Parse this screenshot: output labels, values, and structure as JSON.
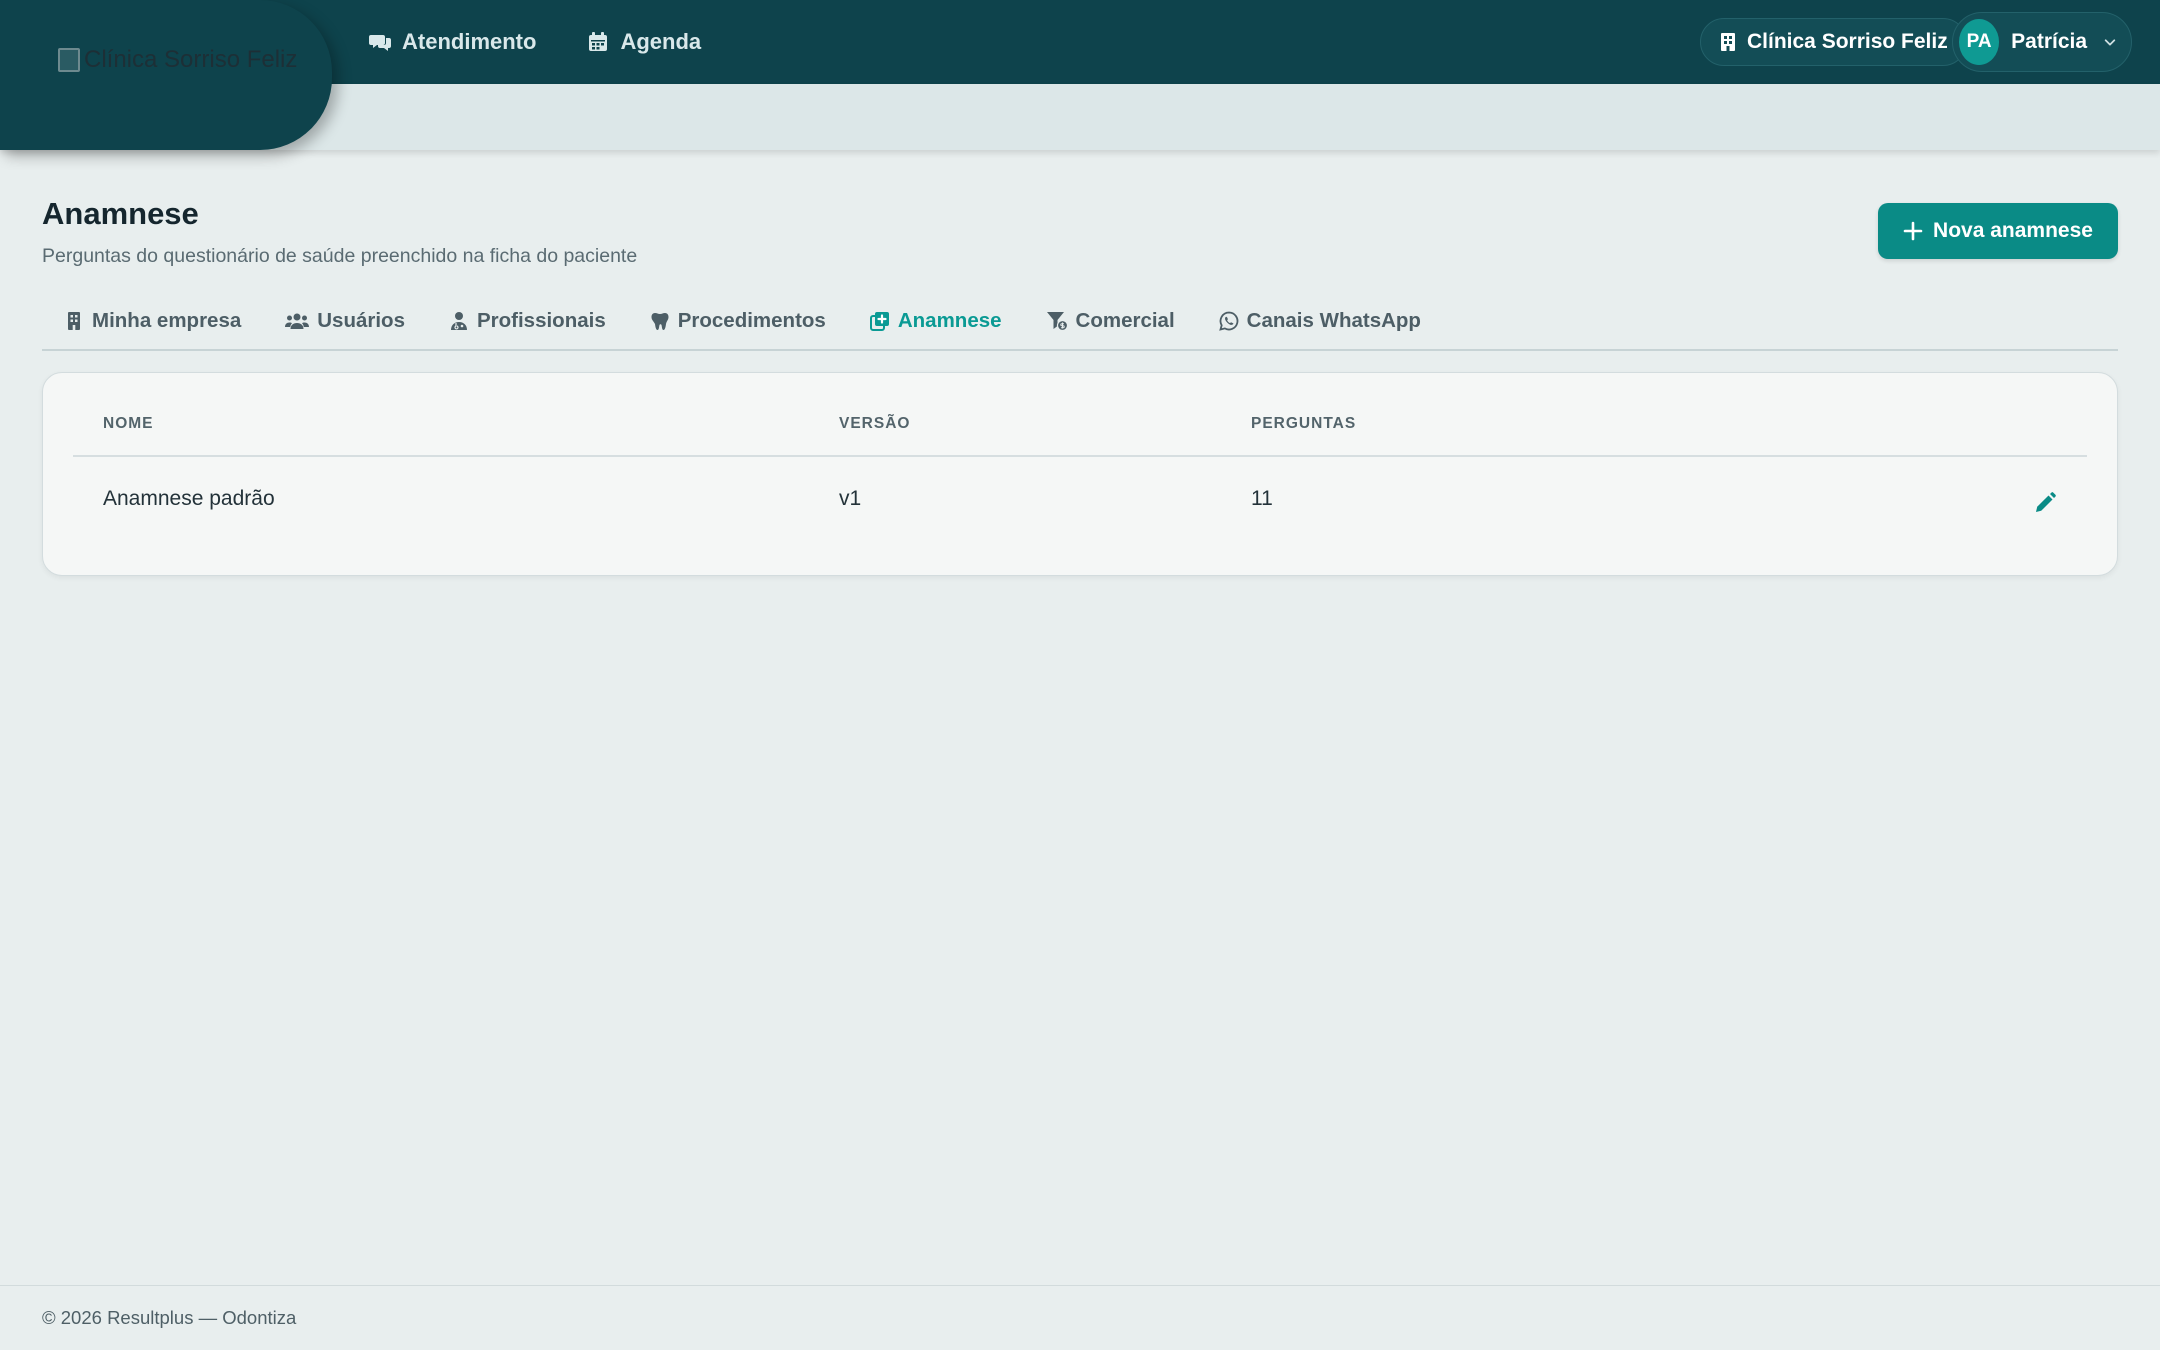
{
  "brand": {
    "logo_alt": "Clínica Sorriso Feliz"
  },
  "topnav": {
    "items": [
      {
        "label": "Atendimento",
        "icon": "chat-bubbles-icon"
      },
      {
        "label": "Agenda",
        "icon": "calendar-icon"
      }
    ]
  },
  "header": {
    "clinic_name": "Clínica Sorriso Feliz",
    "user_initials": "PA",
    "user_name": "Patrícia"
  },
  "page": {
    "title": "Anamnese",
    "subtitle": "Perguntas do questionário de saúde preenchido na ficha do paciente",
    "new_button_label": "Nova anamnese"
  },
  "tabs": [
    {
      "label": "Minha empresa",
      "icon": "building-icon",
      "active": false
    },
    {
      "label": "Usuários",
      "icon": "users-icon",
      "active": false
    },
    {
      "label": "Profissionais",
      "icon": "doctor-icon",
      "active": false
    },
    {
      "label": "Procedimentos",
      "icon": "tooth-icon",
      "active": false
    },
    {
      "label": "Anamnese",
      "icon": "notes-medical-icon",
      "active": true
    },
    {
      "label": "Comercial",
      "icon": "funnel-dollar-icon",
      "active": false
    },
    {
      "label": "Canais WhatsApp",
      "icon": "whatsapp-icon",
      "active": false
    }
  ],
  "table": {
    "columns": [
      "NOME",
      "VERSÃO",
      "PERGUNTAS"
    ],
    "rows": [
      {
        "nome": "Anamnese padrão",
        "versao": "v1",
        "perguntas": "11"
      }
    ]
  },
  "footer": {
    "text": "© 2026 Resultplus — Odontiza"
  },
  "colors": {
    "topbar": "#0e434c",
    "accent": "#0a8b86",
    "active_tab": "#0a9a94",
    "background": "#e8eeee"
  }
}
